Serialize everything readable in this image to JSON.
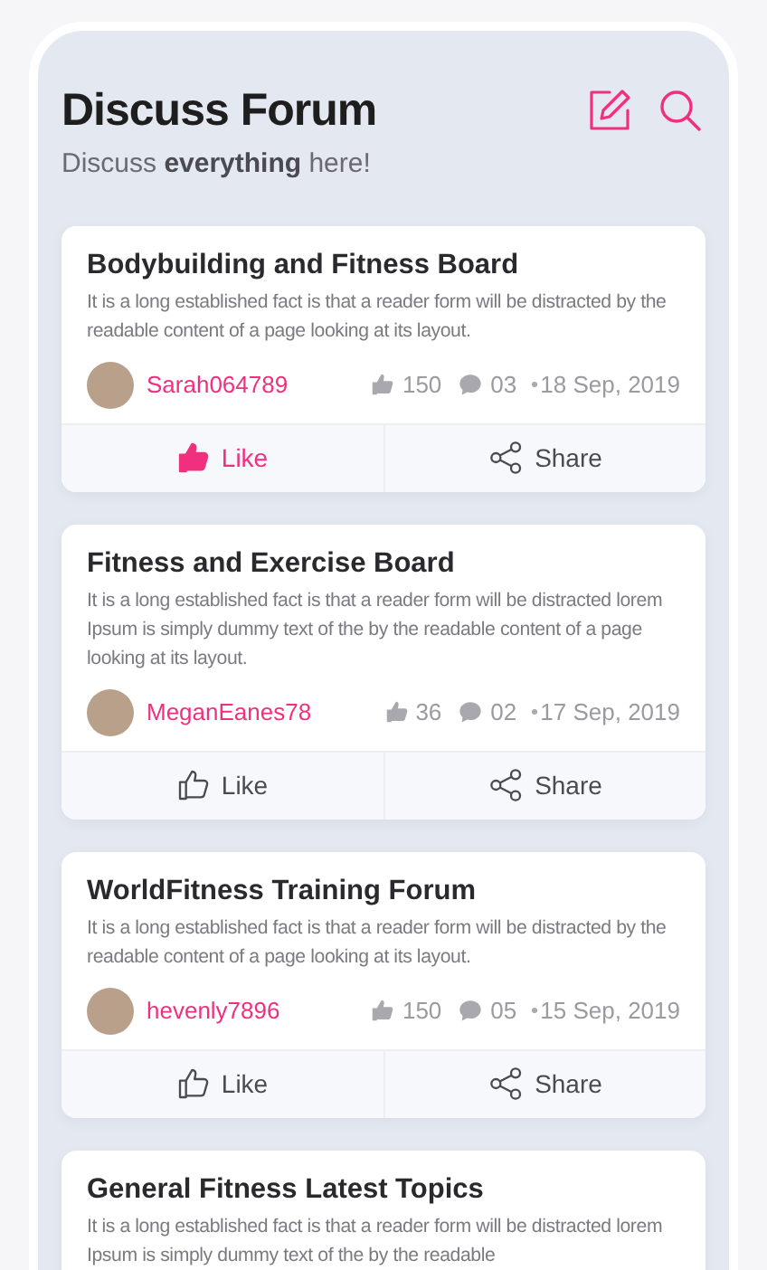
{
  "header": {
    "title": "Discuss Forum",
    "subtitle": "Discuss **everything** here!"
  },
  "posts": [
    {
      "title": "Bodybuilding and Fitness Board",
      "body": "It is a long established fact is that a reader form will be distracted by the readable content of a page looking at its layout.",
      "author": "Sarah064789",
      "likes": "150",
      "comments": "03",
      "date": "18 Sep, 2019",
      "liked": true,
      "like_label": "Like",
      "share_label": "Share"
    },
    {
      "title": "Fitness and Exercise Board",
      "body": "It is a long established fact is that a reader form will be distracted lorem Ipsum is simply dummy text of the by the readable content of a page looking at its layout.",
      "author": "MeganEanes78",
      "likes": "36",
      "comments": "02",
      "date": "17 Sep, 2019",
      "liked": false,
      "like_label": "Like",
      "share_label": "Share"
    },
    {
      "title": "WorldFitness Training Forum",
      "body": "It is a long established fact is that a reader form will be distracted by the readable content of a page looking at its layout.",
      "author": "hevenly7896",
      "likes": "150",
      "comments": "05",
      "date": "15 Sep, 2019",
      "liked": false,
      "like_label": "Like",
      "share_label": "Share"
    },
    {
      "title": "General Fitness Latest Topics",
      "body": "It is a long established fact is that a reader form will be distracted lorem Ipsum is simply dummy text of the by the readable"
    }
  ]
}
